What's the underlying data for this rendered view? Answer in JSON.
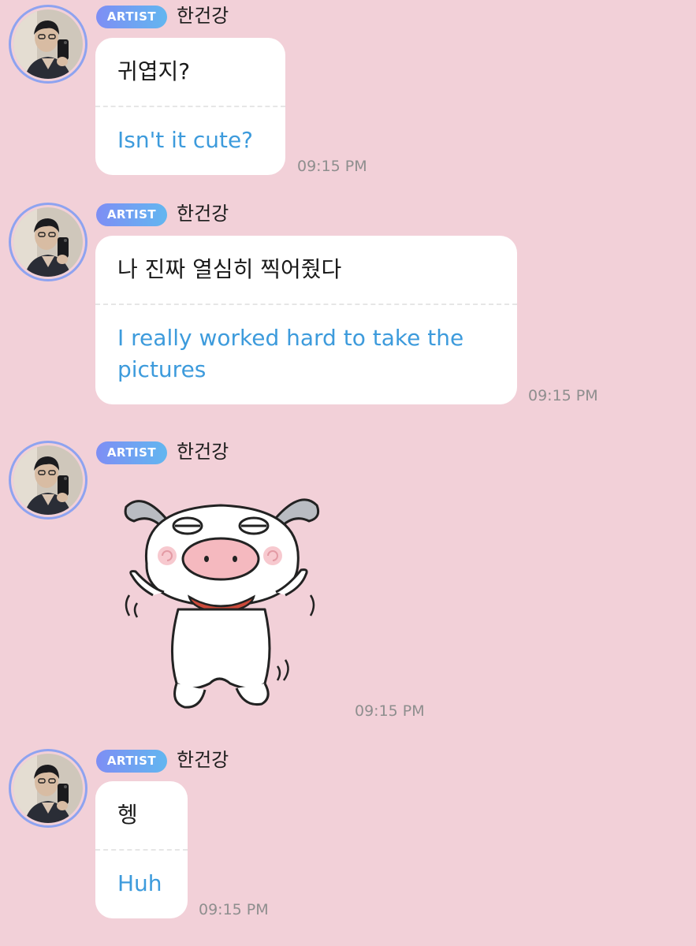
{
  "messages": [
    {
      "badge": "ARTIST",
      "name": "한건강",
      "text_ko": "귀엽지?",
      "text_en": "Isn't it cute?",
      "time": "09:15 PM"
    },
    {
      "badge": "ARTIST",
      "name": "한건강",
      "text_ko": "나 진짜 열심히 찍어줬다",
      "text_en": "I really worked hard to take the pictures",
      "time": "09:15 PM"
    },
    {
      "badge": "ARTIST",
      "name": "한건강",
      "sticker": "white-pig-dancing-sticker",
      "time": "09:15 PM"
    },
    {
      "badge": "ARTIST",
      "name": "한건강",
      "text_ko": "헹",
      "text_en": "Huh",
      "time": "09:15 PM"
    }
  ],
  "colors": {
    "background": "#f2d0d8",
    "bubble": "#ffffff",
    "translation_text": "#3d9bdc",
    "badge_gradient_start": "#7e8ef4",
    "badge_gradient_end": "#62b6f0",
    "avatar_ring": "#8ea3f0",
    "timestamp": "#8e8e8e"
  }
}
